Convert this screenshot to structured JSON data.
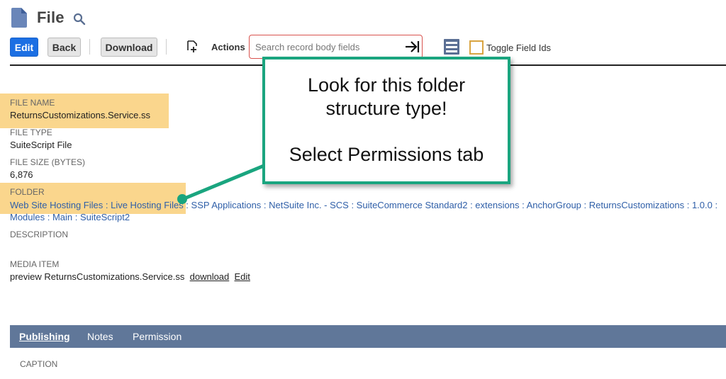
{
  "header": {
    "title": "File",
    "file_icon": "document-icon",
    "search_icon": "search-icon"
  },
  "toolbar": {
    "edit_label": "Edit",
    "back_label": "Back",
    "download_label": "Download",
    "actions_label": "Actions",
    "search_placeholder": "Search record body fields",
    "toggle_label": "Toggle Field Ids"
  },
  "fields": {
    "file_name": {
      "label": "FILE NAME",
      "value": "ReturnsCustomizations.Service.ss"
    },
    "file_type": {
      "label": "FILE TYPE",
      "value": "SuiteScript File"
    },
    "file_size": {
      "label": "FILE SIZE (BYTES)",
      "value": "6,876"
    },
    "folder": {
      "label": "FOLDER",
      "line1": "Web Site Hosting Files : Live Hosting Files : SSP Applications : NetSuite Inc. - SCS : SuiteCommerce Standard2 : extensions : AnchorGroup : ReturnsCustomizations : 1.0.0 :",
      "line2": "Modules : Main : SuiteScript2"
    },
    "description": {
      "label": "DESCRIPTION",
      "value": ""
    },
    "media_item": {
      "label": "MEDIA ITEM",
      "preview_text": "preview ReturnsCustomizations.Service.ss",
      "download_link": "download",
      "edit_link": "Edit"
    }
  },
  "callout": {
    "line1": "Look for this folder",
    "line2": "structure type!",
    "line3": "Select Permissions tab"
  },
  "tabs": [
    {
      "label": "Publishing",
      "active": true
    },
    {
      "label": "Notes",
      "active": false
    },
    {
      "label": "Permission",
      "active": false
    }
  ],
  "publishing": {
    "caption_label": "CAPTION"
  },
  "colors": {
    "primary_button": "#1c6fe3",
    "highlight": "#fad68d",
    "callout_border": "#1aa57f",
    "tab_bar": "#607799",
    "link": "#2f5fa8"
  }
}
